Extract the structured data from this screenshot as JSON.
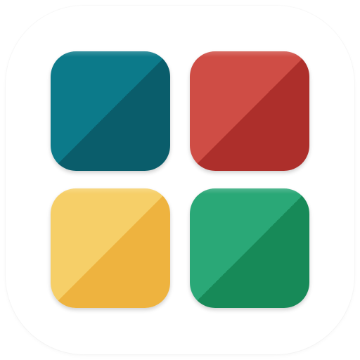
{
  "icon": {
    "name": "app-grid-icon",
    "tiles": [
      {
        "name": "teal-tile",
        "light": "#0c7a8a",
        "dark": "#0a5d6b"
      },
      {
        "name": "red-tile",
        "light": "#cf4d45",
        "dark": "#ad2f2b"
      },
      {
        "name": "yellow-tile",
        "light": "#f6cf68",
        "dark": "#eeb33f"
      },
      {
        "name": "green-tile",
        "light": "#2aa877",
        "dark": "#178a58"
      }
    ],
    "background": "#ffffff"
  }
}
